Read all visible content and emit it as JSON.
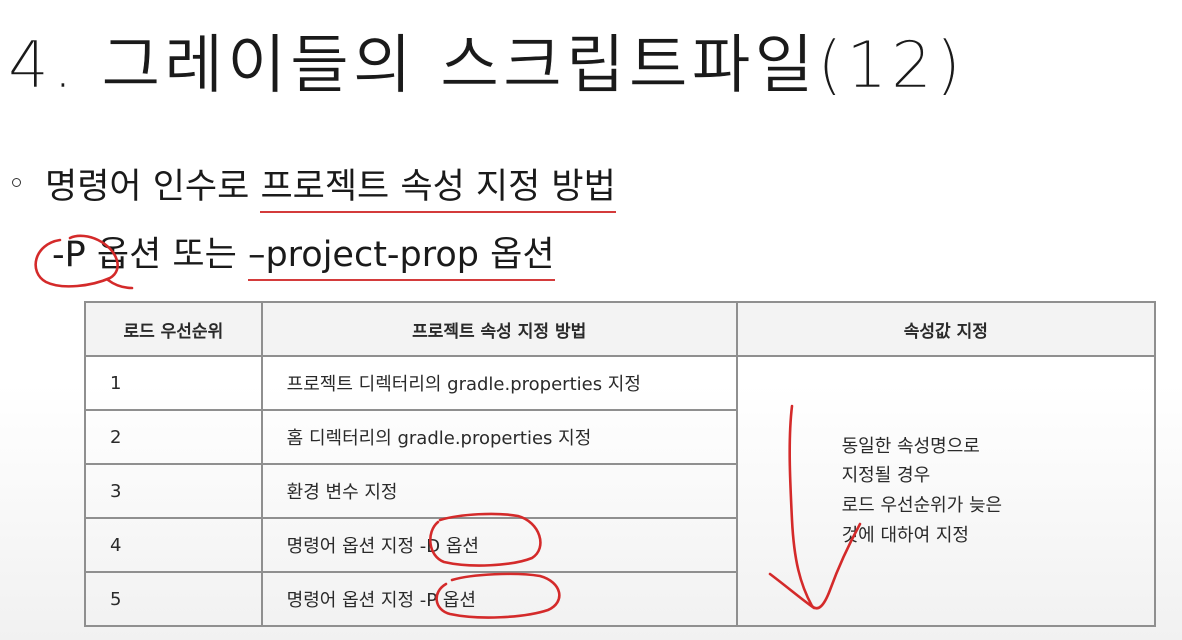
{
  "slide": {
    "title": "4. 그레이들의 스크립트파일(12)",
    "bullet": {
      "prefix": "명령어 인수로 ",
      "underlined": "프로젝트 속성 지정 방법"
    },
    "subline": {
      "p_option": "-P",
      "middle": " 옵션 또는 ",
      "long_option": "–project-prop 옵션"
    }
  },
  "table": {
    "headers": [
      "로드 우선순위",
      "프로젝트 속성 지정 방법",
      "속성값 지정"
    ],
    "rows": [
      {
        "priority": "1",
        "method": "프로젝트 디렉터리의 gradle.properties 지정"
      },
      {
        "priority": "2",
        "method": "홈 디렉터리의 gradle.properties 지정"
      },
      {
        "priority": "3",
        "method": "환경 변수 지정"
      },
      {
        "priority": "4",
        "method_prefix": "명령어 옵션 지정",
        "method_option": " -D 옵션"
      },
      {
        "priority": "5",
        "method_prefix": "명령어 옵션 지정",
        "method_option": " -P 옵션"
      }
    ],
    "merged_note": [
      "동일한 속성명으로",
      "지정될 경우",
      "로드 우선순위가 늦은",
      "것에 대하여 지정"
    ]
  },
  "colors": {
    "annotation": "#d42a2a",
    "text": "#1a1a1a",
    "border": "#8f8f8f"
  }
}
